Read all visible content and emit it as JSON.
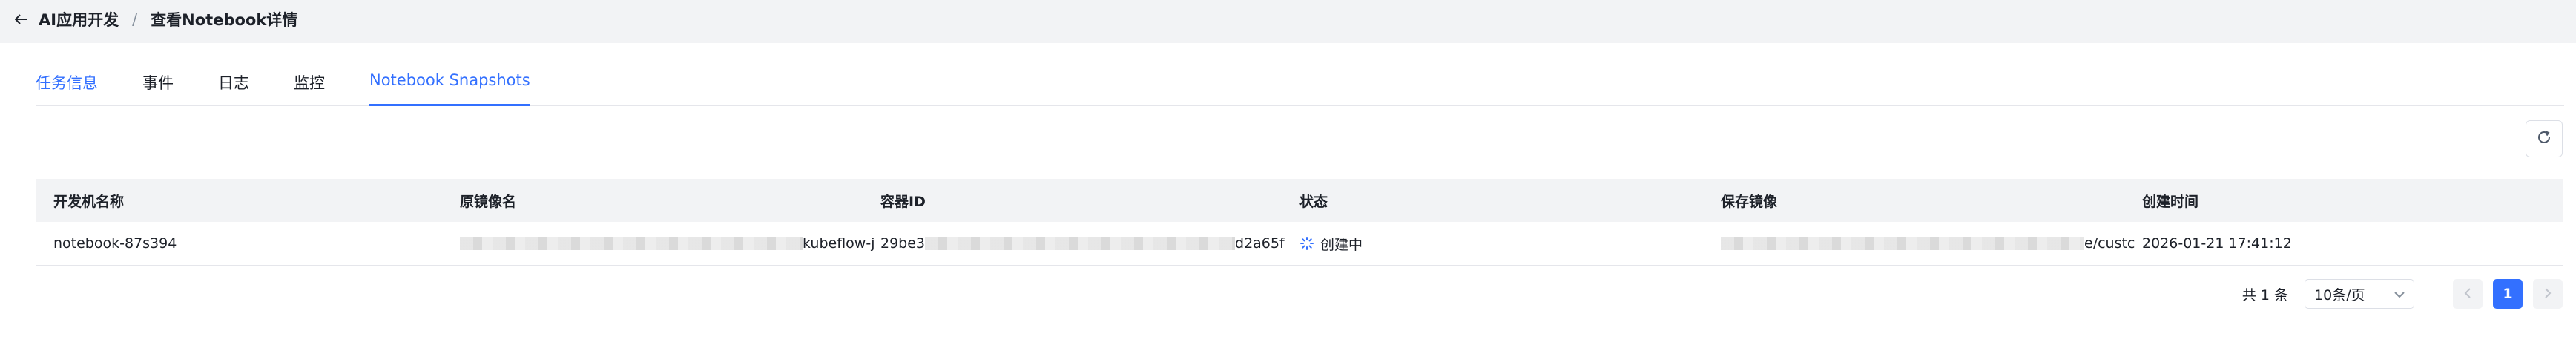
{
  "breadcrumb": {
    "parent": "AI应用开发",
    "separator": "/",
    "current": "查看Notebook详情"
  },
  "tabs": [
    {
      "label": "任务信息"
    },
    {
      "label": "事件"
    },
    {
      "label": "日志"
    },
    {
      "label": "监控"
    },
    {
      "label": "Notebook Snapshots",
      "active": true
    }
  ],
  "table": {
    "headers": [
      "开发机名称",
      "原镜像名",
      "容器ID",
      "状态",
      "保存镜像",
      "创建时间"
    ],
    "rows": [
      {
        "dev_name": "notebook-87s394",
        "orig_image_suffix": "kubeflow-j",
        "container_prefix": "29be3",
        "container_suffix": "d2a65f",
        "status": "创建中",
        "save_image_suffix": "e/custc",
        "created_at": "2026-01-21 17:41:12"
      }
    ]
  },
  "pagination": {
    "total": "共 1 条",
    "page_size": "10条/页",
    "current_page": "1"
  },
  "colors": {
    "accent": "#3370ff",
    "background": "#f2f3f5"
  },
  "icons": {
    "back": "arrow-left-icon",
    "refresh": "refresh-icon",
    "status": "loading-icon",
    "dropdown": "chevron-down-icon",
    "prev": "chevron-left-icon",
    "next": "chevron-right-icon"
  }
}
